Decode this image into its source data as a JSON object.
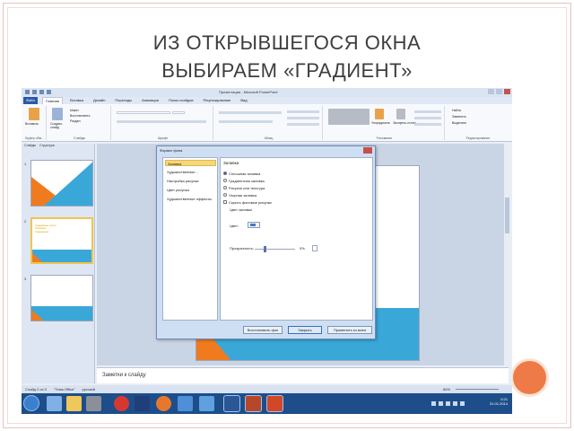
{
  "slide": {
    "title_line1": "ИЗ ОТКРЫВШЕГОСЯ ОКНА",
    "title_line2": "ВЫБИРАЕМ «ГРАДИЕНТ»"
  },
  "app": {
    "window_title": "Презентация - Microsoft PowerPoint",
    "tabs": [
      "Файл",
      "Главная",
      "Вставка",
      "Дизайн",
      "Переходы",
      "Анимация",
      "Показ слайдов",
      "Рецензирование",
      "Вид"
    ],
    "active_tab": "Главная",
    "ribbon_groups": {
      "clipboard": "Буфер обм...",
      "slides": "Слайды",
      "font": "Шрифт",
      "paragraph": "Абзац",
      "drawing": "Рисование",
      "editing": "Редактирование"
    },
    "ribbon_buttons": {
      "paste": "Вставить",
      "new_slide": "Создать слайд",
      "layout": "Макет",
      "reset": "Восстановить",
      "section": "Раздел",
      "arrange": "Упорядочить",
      "quick_styles": "Экспресс-стили",
      "find": "Найти",
      "replace": "Заменить",
      "select": "Выделить"
    },
    "left_pane_tabs": [
      "Слайды",
      "Структура"
    ],
    "thumbnails": [
      {
        "num": "1"
      },
      {
        "num": "2",
        "lines": [
          "Содержание текста",
          "Описание",
          "Содержание"
        ]
      },
      {
        "num": "3"
      }
    ],
    "notes_placeholder": "Заметки к слайду",
    "status": {
      "slide_indicator": "Слайд 2 из 3",
      "theme": "\"Тема Office\"",
      "language": "русский",
      "zoom": "66%"
    },
    "clock": {
      "time": "0:21",
      "date": "31.01.2014"
    },
    "accent_orange": "#f07b1e",
    "accent_blue": "#3aa7d9"
  },
  "dialog": {
    "title": "Формат фона",
    "nav_items": [
      "Заливка",
      "Художественные...",
      "Настройка рисунка",
      "Цвет рисунка",
      "Художественные эффекты"
    ],
    "active_nav": "Заливка",
    "panel_title": "Заливка",
    "fill_options": [
      {
        "label": "Сплошная заливка",
        "checked": true
      },
      {
        "label": "Градиентная заливка",
        "checked": false
      },
      {
        "label": "Рисунок или текстура",
        "checked": false
      },
      {
        "label": "Узорная заливка",
        "checked": false
      }
    ],
    "hide_background_label": "Скрыть фоновые рисунки",
    "fill_color_label": "Цвет заливки",
    "color_label": "Цвет:",
    "transparency_label": "Прозрачность:",
    "transparency_value": "0%",
    "buttons": {
      "reset": "Восстановить фон",
      "close": "Закрыть",
      "apply_all": "Применить ко всем"
    }
  }
}
